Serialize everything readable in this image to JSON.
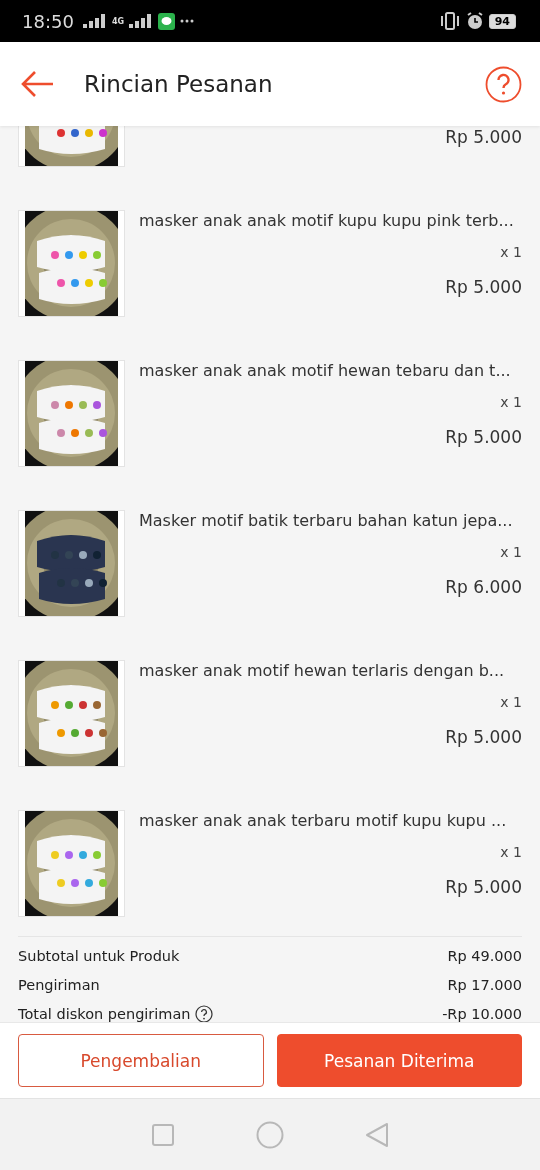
{
  "status_bar": {
    "time": "18:50",
    "network": "4G",
    "battery": "94"
  },
  "header": {
    "title": "Rincian Pesanan"
  },
  "items": [
    {
      "price": "Rp 5.000"
    },
    {
      "name": "masker anak anak motif kupu kupu pink terb...",
      "quantity": "x 1",
      "price": "Rp 5.000"
    },
    {
      "name": "masker anak anak motif hewan tebaru dan t...",
      "quantity": "x 1",
      "price": "Rp 5.000"
    },
    {
      "name": "Masker motif batik terbaru bahan katun jepa...",
      "quantity": "x 1",
      "price": "Rp 6.000"
    },
    {
      "name": "masker anak motif hewan terlaris dengan b...",
      "quantity": "x 1",
      "price": "Rp 5.000"
    },
    {
      "name": "masker anak anak terbaru motif kupu kupu ...",
      "quantity": "x 1",
      "price": "Rp 5.000"
    }
  ],
  "summary": [
    {
      "label": "Subtotal untuk Produk",
      "value": "Rp 49.000",
      "help": false
    },
    {
      "label": "Pengiriman",
      "value": "Rp 17.000",
      "help": false
    },
    {
      "label": "Total diskon pengiriman",
      "value": "-Rp 10.000",
      "help": true
    }
  ],
  "buttons": [
    {
      "label": "Pengembalian",
      "primary": false
    },
    {
      "label": "Pesanan Diterima",
      "primary": true
    }
  ]
}
